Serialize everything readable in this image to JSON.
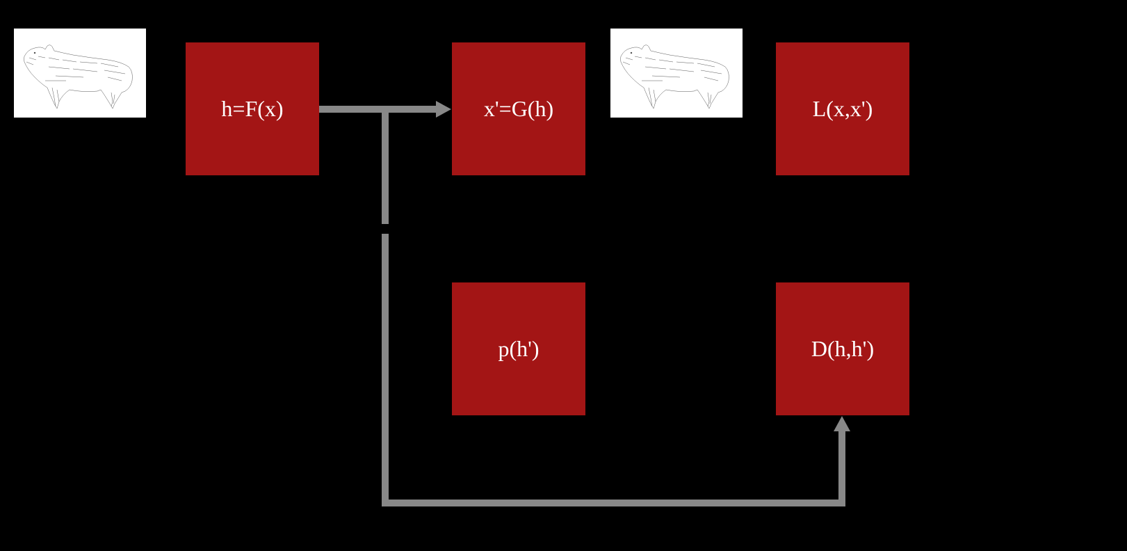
{
  "nodes": {
    "encoder": "h=F(x)",
    "decoder": "x'=G(h)",
    "loss": "L(x,x')",
    "prior": "p(h')",
    "discriminator": "D(h,h')"
  },
  "images": {
    "input": "wolf-stipple",
    "reconstruction": "wolf-stipple"
  },
  "colors": {
    "background": "#000000",
    "box": "#a31515",
    "text": "#ffffff",
    "arrow": "#888888",
    "imageBg": "#ffffff"
  }
}
